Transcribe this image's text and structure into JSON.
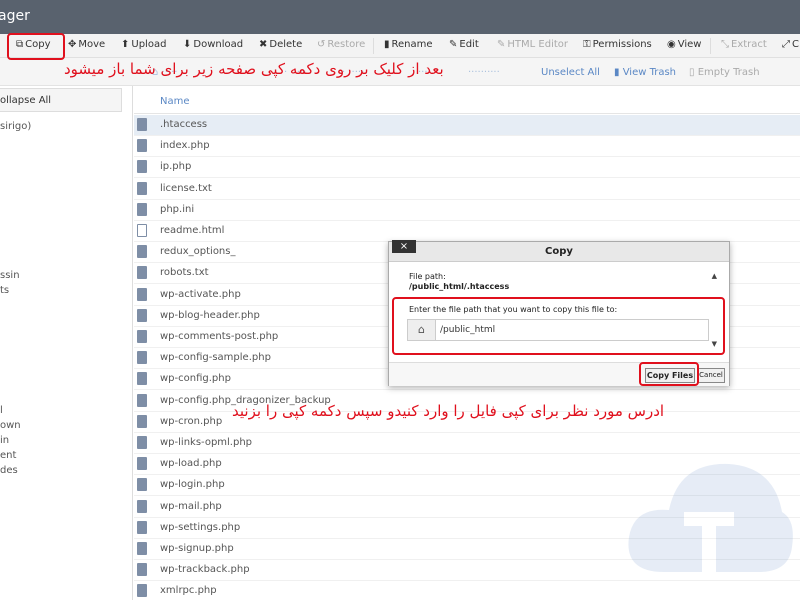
{
  "window": {
    "title": "ager"
  },
  "toolbar": {
    "buttons": [
      {
        "label": "Copy",
        "icon": "copy-icon",
        "enabled": true
      },
      {
        "label": "Move",
        "icon": "move-icon",
        "enabled": true
      },
      {
        "label": "Upload",
        "icon": "upload-icon",
        "enabled": true
      },
      {
        "label": "Download",
        "icon": "download-icon",
        "enabled": true
      },
      {
        "label": "Delete",
        "icon": "delete-icon",
        "enabled": true
      },
      {
        "label": "Restore",
        "icon": "restore-icon",
        "enabled": false
      },
      {
        "label": "Rename",
        "icon": "rename-icon",
        "enabled": true
      },
      {
        "label": "Edit",
        "icon": "edit-icon",
        "enabled": true
      },
      {
        "label": "HTML Editor",
        "icon": "html-editor-icon",
        "enabled": false
      },
      {
        "label": "Permissions",
        "icon": "permissions-icon",
        "enabled": true
      },
      {
        "label": "View",
        "icon": "view-icon",
        "enabled": true
      },
      {
        "label": "Extract",
        "icon": "extract-icon",
        "enabled": false
      },
      {
        "label": "C",
        "icon": "compress-icon",
        "enabled": true
      }
    ]
  },
  "toolbar2": {
    "unselect_all": "Unselect All",
    "view_trash": "View Trash",
    "empty_trash": "Empty Trash"
  },
  "sidebar": {
    "collapse_all": "ollapse All",
    "items": [
      "sirigo)",
      "ssin",
      "ts",
      "l",
      "own",
      "in",
      "ent",
      "des"
    ]
  },
  "filelist": {
    "column_name": "Name",
    "files": [
      ".htaccess",
      "index.php",
      "ip.php",
      "license.txt",
      "php.ini",
      "readme.html",
      "redux_options_",
      "robots.txt",
      "wp-activate.php",
      "wp-blog-header.php",
      "wp-comments-post.php",
      "wp-config-sample.php",
      "wp-config.php",
      "wp-config.php_dragonizer_backup",
      "wp-cron.php",
      "wp-links-opml.php",
      "wp-load.php",
      "wp-login.php",
      "wp-mail.php",
      "wp-settings.php",
      "wp-signup.php",
      "wp-trackback.php",
      "xmlrpc.php"
    ],
    "selected_index": 0
  },
  "dialog": {
    "title": "Copy",
    "close_label": "×",
    "file_path_label": "File path:",
    "file_path_value": "/public_html/.htaccess",
    "enter_label": "Enter the file path that you want to copy this file to:",
    "path_value": "/public_html",
    "copy_files_label": "Copy Files",
    "cancel_label": "Cancel"
  },
  "annotations": {
    "top": "بعد از کلیک بر روی دکمه کپی صفحه زیر برای شما باز میشود",
    "bottom": "ادرس مورد نظر برای کپی فایل را وارد کنیدو سپس دکمه کپی را بزنید"
  },
  "colors": {
    "accent": "#5b88c5",
    "annotation": "#e0101d",
    "titlebar": "#59626e"
  }
}
